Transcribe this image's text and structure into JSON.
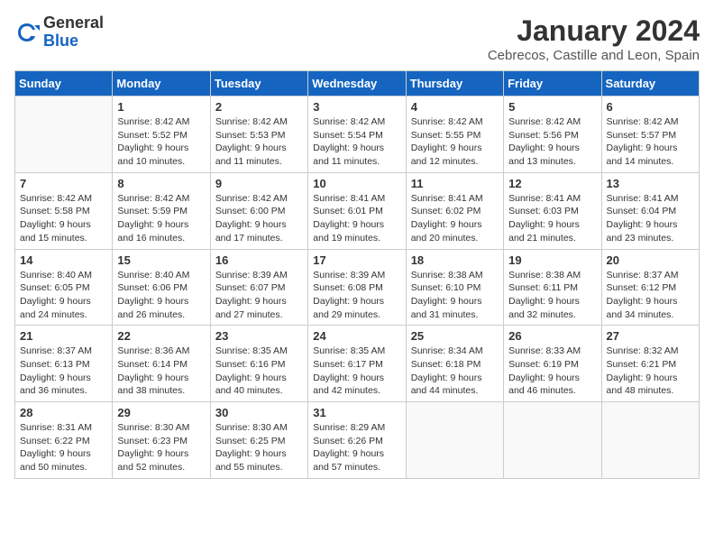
{
  "logo": {
    "general": "General",
    "blue": "Blue"
  },
  "title": "January 2024",
  "subtitle": "Cebrecos, Castille and Leon, Spain",
  "days_of_week": [
    "Sunday",
    "Monday",
    "Tuesday",
    "Wednesday",
    "Thursday",
    "Friday",
    "Saturday"
  ],
  "weeks": [
    [
      {
        "day": "",
        "info": ""
      },
      {
        "day": "1",
        "info": "Sunrise: 8:42 AM\nSunset: 5:52 PM\nDaylight: 9 hours\nand 10 minutes."
      },
      {
        "day": "2",
        "info": "Sunrise: 8:42 AM\nSunset: 5:53 PM\nDaylight: 9 hours\nand 11 minutes."
      },
      {
        "day": "3",
        "info": "Sunrise: 8:42 AM\nSunset: 5:54 PM\nDaylight: 9 hours\nand 11 minutes."
      },
      {
        "day": "4",
        "info": "Sunrise: 8:42 AM\nSunset: 5:55 PM\nDaylight: 9 hours\nand 12 minutes."
      },
      {
        "day": "5",
        "info": "Sunrise: 8:42 AM\nSunset: 5:56 PM\nDaylight: 9 hours\nand 13 minutes."
      },
      {
        "day": "6",
        "info": "Sunrise: 8:42 AM\nSunset: 5:57 PM\nDaylight: 9 hours\nand 14 minutes."
      }
    ],
    [
      {
        "day": "7",
        "info": "Sunrise: 8:42 AM\nSunset: 5:58 PM\nDaylight: 9 hours\nand 15 minutes."
      },
      {
        "day": "8",
        "info": "Sunrise: 8:42 AM\nSunset: 5:59 PM\nDaylight: 9 hours\nand 16 minutes."
      },
      {
        "day": "9",
        "info": "Sunrise: 8:42 AM\nSunset: 6:00 PM\nDaylight: 9 hours\nand 17 minutes."
      },
      {
        "day": "10",
        "info": "Sunrise: 8:41 AM\nSunset: 6:01 PM\nDaylight: 9 hours\nand 19 minutes."
      },
      {
        "day": "11",
        "info": "Sunrise: 8:41 AM\nSunset: 6:02 PM\nDaylight: 9 hours\nand 20 minutes."
      },
      {
        "day": "12",
        "info": "Sunrise: 8:41 AM\nSunset: 6:03 PM\nDaylight: 9 hours\nand 21 minutes."
      },
      {
        "day": "13",
        "info": "Sunrise: 8:41 AM\nSunset: 6:04 PM\nDaylight: 9 hours\nand 23 minutes."
      }
    ],
    [
      {
        "day": "14",
        "info": "Sunrise: 8:40 AM\nSunset: 6:05 PM\nDaylight: 9 hours\nand 24 minutes."
      },
      {
        "day": "15",
        "info": "Sunrise: 8:40 AM\nSunset: 6:06 PM\nDaylight: 9 hours\nand 26 minutes."
      },
      {
        "day": "16",
        "info": "Sunrise: 8:39 AM\nSunset: 6:07 PM\nDaylight: 9 hours\nand 27 minutes."
      },
      {
        "day": "17",
        "info": "Sunrise: 8:39 AM\nSunset: 6:08 PM\nDaylight: 9 hours\nand 29 minutes."
      },
      {
        "day": "18",
        "info": "Sunrise: 8:38 AM\nSunset: 6:10 PM\nDaylight: 9 hours\nand 31 minutes."
      },
      {
        "day": "19",
        "info": "Sunrise: 8:38 AM\nSunset: 6:11 PM\nDaylight: 9 hours\nand 32 minutes."
      },
      {
        "day": "20",
        "info": "Sunrise: 8:37 AM\nSunset: 6:12 PM\nDaylight: 9 hours\nand 34 minutes."
      }
    ],
    [
      {
        "day": "21",
        "info": "Sunrise: 8:37 AM\nSunset: 6:13 PM\nDaylight: 9 hours\nand 36 minutes."
      },
      {
        "day": "22",
        "info": "Sunrise: 8:36 AM\nSunset: 6:14 PM\nDaylight: 9 hours\nand 38 minutes."
      },
      {
        "day": "23",
        "info": "Sunrise: 8:35 AM\nSunset: 6:16 PM\nDaylight: 9 hours\nand 40 minutes."
      },
      {
        "day": "24",
        "info": "Sunrise: 8:35 AM\nSunset: 6:17 PM\nDaylight: 9 hours\nand 42 minutes."
      },
      {
        "day": "25",
        "info": "Sunrise: 8:34 AM\nSunset: 6:18 PM\nDaylight: 9 hours\nand 44 minutes."
      },
      {
        "day": "26",
        "info": "Sunrise: 8:33 AM\nSunset: 6:19 PM\nDaylight: 9 hours\nand 46 minutes."
      },
      {
        "day": "27",
        "info": "Sunrise: 8:32 AM\nSunset: 6:21 PM\nDaylight: 9 hours\nand 48 minutes."
      }
    ],
    [
      {
        "day": "28",
        "info": "Sunrise: 8:31 AM\nSunset: 6:22 PM\nDaylight: 9 hours\nand 50 minutes."
      },
      {
        "day": "29",
        "info": "Sunrise: 8:30 AM\nSunset: 6:23 PM\nDaylight: 9 hours\nand 52 minutes."
      },
      {
        "day": "30",
        "info": "Sunrise: 8:30 AM\nSunset: 6:25 PM\nDaylight: 9 hours\nand 55 minutes."
      },
      {
        "day": "31",
        "info": "Sunrise: 8:29 AM\nSunset: 6:26 PM\nDaylight: 9 hours\nand 57 minutes."
      },
      {
        "day": "",
        "info": ""
      },
      {
        "day": "",
        "info": ""
      },
      {
        "day": "",
        "info": ""
      }
    ]
  ]
}
